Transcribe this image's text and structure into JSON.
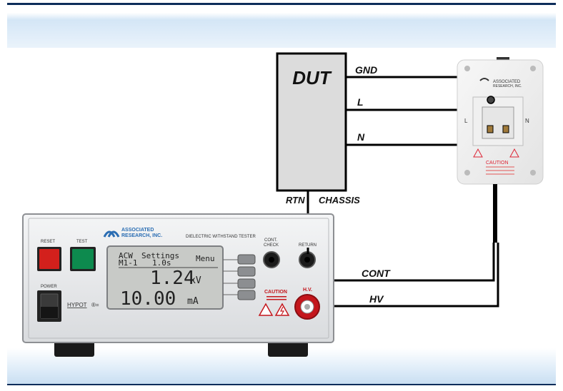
{
  "dut": {
    "title": "DUT",
    "gnd": "GND",
    "l": "L",
    "n": "N",
    "rtn": "RTN",
    "chassis": "CHASSIS"
  },
  "wires": {
    "cont": "CONT",
    "hv": "HV"
  },
  "tester": {
    "brand_line1": "ASSOCIATED",
    "brand_line2": "RESEARCH, INC.",
    "model_title": "DIELECTRIC WITHSTAND TESTER",
    "reset_label": "RESET",
    "test_label": "TEST",
    "power_label": "POWER",
    "hypot_label": "HYPOT",
    "cont_check_label_1": "CONT.",
    "cont_check_label_2": "CHECK",
    "return_label": "RETURN",
    "caution_label": "CAUTION",
    "hv_label": "H.V.",
    "colors": {
      "reset": "#d3201c",
      "test": "#0d8a4e",
      "hv_ring": "#c4161c",
      "panel": "#e7e8ea"
    },
    "lcd": {
      "mode": "ACW",
      "settings": "Settings",
      "menu": "Menu",
      "memory": "M1-1",
      "time": "1.0s",
      "voltage": "1.24",
      "voltage_unit": "kV",
      "current": "10.00",
      "current_unit": "mA"
    }
  },
  "outlet": {
    "brand_line1": "ASSOCIATED",
    "brand_line2": "RESEARCH, INC.",
    "l_mark": "L",
    "n_mark": "N",
    "caution": "CAUTION"
  }
}
